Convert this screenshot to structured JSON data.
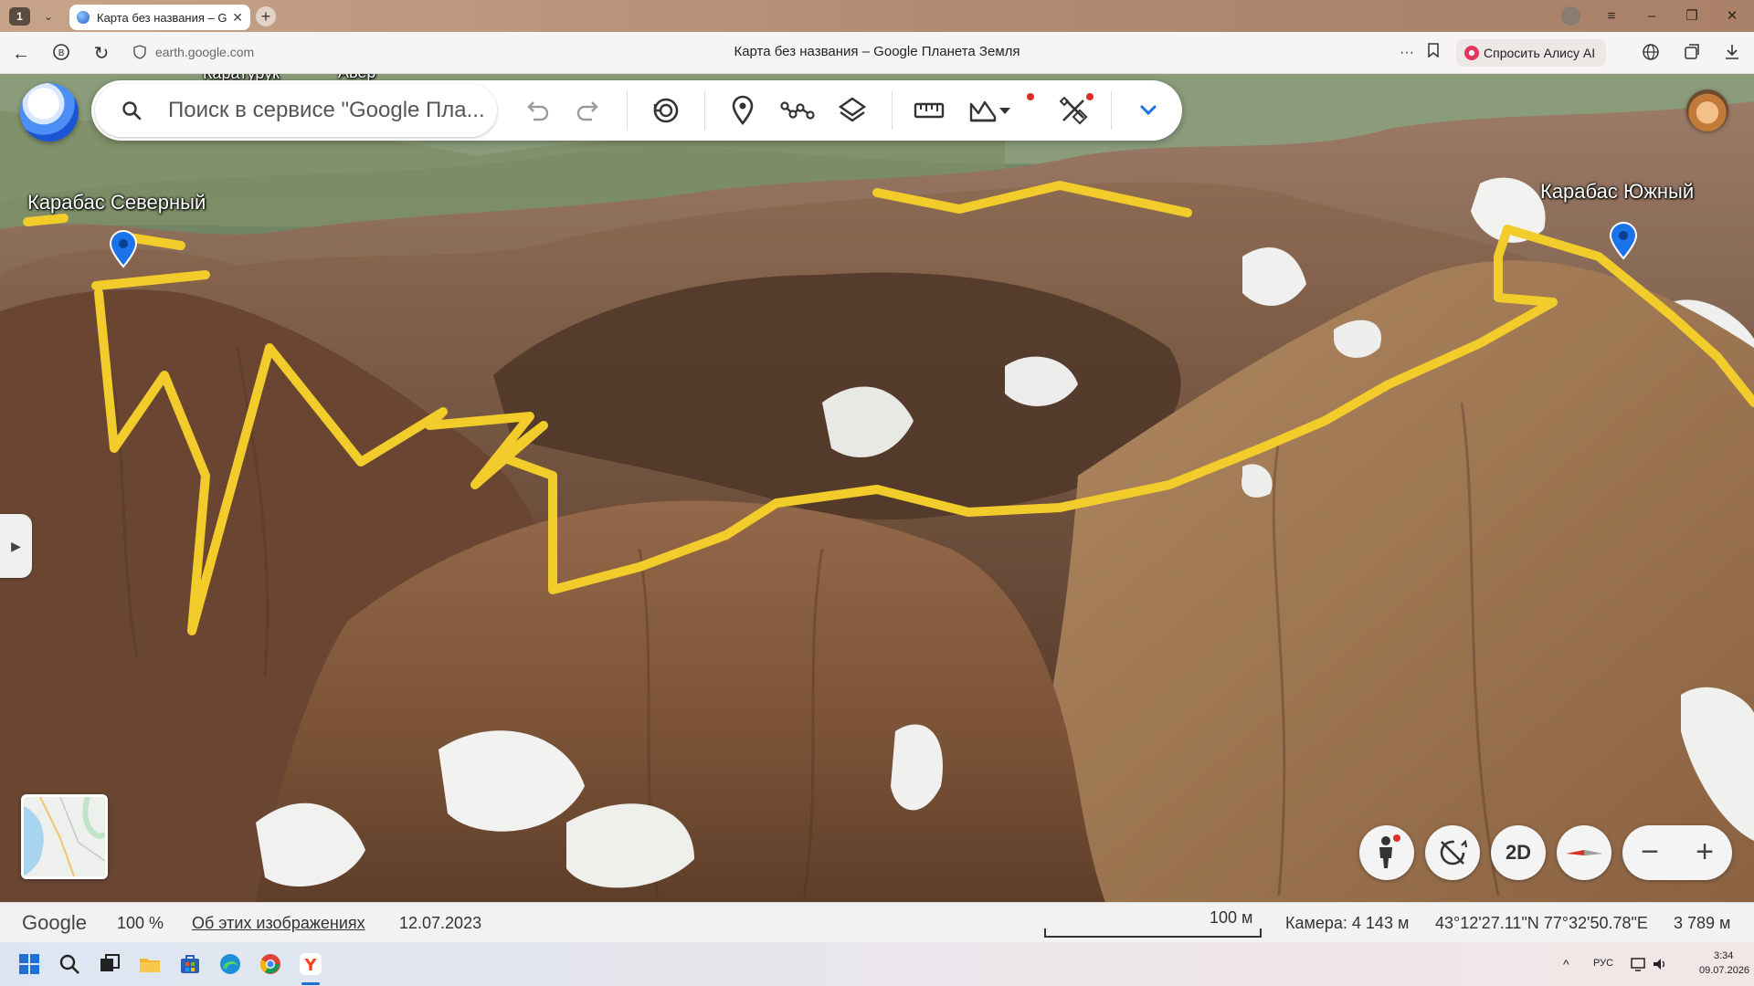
{
  "browser": {
    "tab_count": "1",
    "tab_title": "Карта без названия – G",
    "url": "earth.google.com",
    "page_title": "Карта без названия – Google Планета Земля",
    "alice_label": "Спросить Алису AI"
  },
  "search": {
    "placeholder": "Поиск в сервисе \"Google Пла..."
  },
  "map": {
    "labels": {
      "top_left_1": "Каратурук",
      "top_left_2": "Авер",
      "peak_north": "Карабас Северный",
      "peak_south": "Карабас Южный"
    },
    "route_color": "#f2cc2a",
    "pin_color": "#1a73e8"
  },
  "controls": {
    "view_2d": "2D",
    "zoom_out": "−",
    "zoom_in": "+"
  },
  "status": {
    "brand": "Google",
    "zoom": "100 %",
    "about": "Об этих изображениях",
    "date": "12.07.2023",
    "scale": "100 м",
    "camera": "Камера: 4 143 м",
    "coords": "43°12'27.11\"N 77°32'50.78\"E",
    "elevation": "3 789 м"
  },
  "taskbar": {
    "lang": "РУС",
    "time": "3:34",
    "date": "09.07.2026"
  }
}
